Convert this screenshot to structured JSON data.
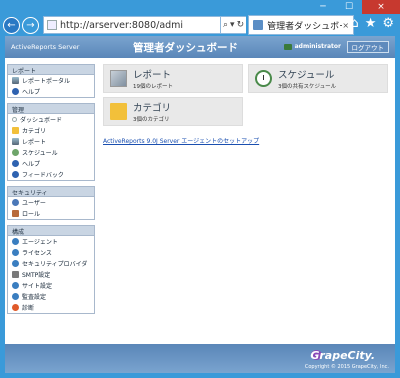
{
  "browser": {
    "url": "http://arserver:8080/admi",
    "tab_title": "管理者ダッシュボード",
    "close_glyph": "×",
    "minimize_glyph": "─",
    "maximize_glyph": "☐",
    "back_glyph": "←",
    "forward_glyph": "→",
    "search_glyph": "⌕",
    "dropdown_glyph": "▾",
    "refresh_glyph": "↻",
    "home_glyph": "⌂",
    "favorites_glyph": "★",
    "settings_glyph": "⚙"
  },
  "header": {
    "brand": "ActiveReports Server",
    "title": "管理者ダッシュボード",
    "user": "administrator",
    "logout": "ログアウト"
  },
  "sidebar": {
    "groups": [
      {
        "title": "レポート",
        "items": [
          {
            "label": "レポートポータル",
            "icon": "report-icon"
          },
          {
            "label": "ヘルプ",
            "icon": "help-icon"
          }
        ]
      },
      {
        "title": "管理",
        "items": [
          {
            "label": "ダッシュボード",
            "icon": "dashboard-icon"
          },
          {
            "label": "カテゴリ",
            "icon": "folder-icon"
          },
          {
            "label": "レポート",
            "icon": "report-icon"
          },
          {
            "label": "スケジュール",
            "icon": "clock-icon"
          },
          {
            "label": "ヘルプ",
            "icon": "help-icon"
          },
          {
            "label": "フィードバック",
            "icon": "feedback-icon"
          }
        ]
      },
      {
        "title": "セキュリティ",
        "items": [
          {
            "label": "ユーザー",
            "icon": "user-icon"
          },
          {
            "label": "ロール",
            "icon": "role-icon"
          }
        ]
      },
      {
        "title": "構成",
        "items": [
          {
            "label": "エージェント",
            "icon": "gear-icon"
          },
          {
            "label": "ライセンス",
            "icon": "gear-icon"
          },
          {
            "label": "セキュリティプロバイダ",
            "icon": "gear-icon"
          },
          {
            "label": "SMTP設定",
            "icon": "smtp-icon"
          },
          {
            "label": "サイト設定",
            "icon": "gear-icon"
          },
          {
            "label": "監査設定",
            "icon": "gear-icon"
          },
          {
            "label": "診断",
            "icon": "diagnostics-icon"
          }
        ]
      }
    ]
  },
  "tiles": {
    "reports": {
      "title": "レポート",
      "subtitle": "19個のレポート"
    },
    "schedules": {
      "title": "スケジュール",
      "subtitle": "3個の共有スケジュール"
    },
    "categories": {
      "title": "カテゴリ",
      "subtitle": "3個のカテゴリ"
    }
  },
  "setup_link": "ActiveReports 9.0J Server エージェントのセットアップ",
  "footer": {
    "logo": "GrapeCity.",
    "copyright": "Copyright © 2015 GrapeCity, Inc."
  }
}
